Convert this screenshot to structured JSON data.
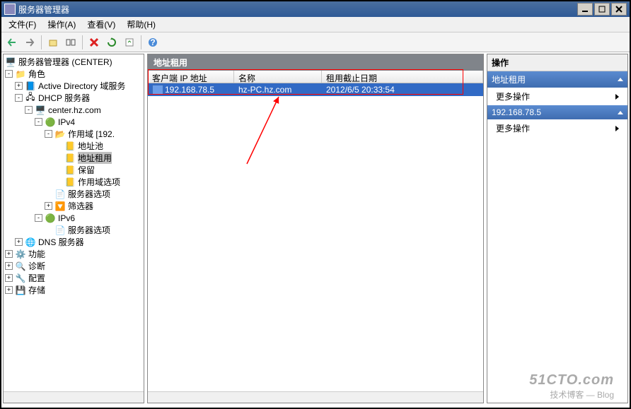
{
  "window": {
    "title": "服务器管理器"
  },
  "menu": {
    "file": "文件(F)",
    "action": "操作(A)",
    "view": "查看(V)",
    "help": "帮助(H)"
  },
  "tree": {
    "root": "服务器管理器 (CENTER)",
    "roles": "角色",
    "ad": "Active Directory 域服务",
    "dhcp": "DHCP 服务器",
    "center": "center.hz.com",
    "ipv4": "IPv4",
    "scope": "作用域 [192.",
    "pool": "地址池",
    "lease": "地址租用",
    "resv": "保留",
    "scopeopt": "作用域选项",
    "srvopt": "服务器选项",
    "filter": "筛选器",
    "ipv6": "IPv6",
    "srvopt6": "服务器选项",
    "dns": "DNS 服务器",
    "features": "功能",
    "diag": "诊断",
    "config": "配置",
    "storage": "存储"
  },
  "center": {
    "title": "地址租用",
    "col1": "客户端 IP 地址",
    "col2": "名称",
    "col3": "租用截止日期",
    "row": {
      "ip": "192.168.78.5",
      "name": "hz-PC.hz.com",
      "expiry": "2012/6/5 20:33:54"
    }
  },
  "actions": {
    "header": "操作",
    "cat1": "地址租用",
    "more1": "更多操作",
    "cat2": "192.168.78.5",
    "more2": "更多操作"
  },
  "watermark": {
    "line1": "51CTO.com",
    "line2": "技术博客 — Blog"
  }
}
